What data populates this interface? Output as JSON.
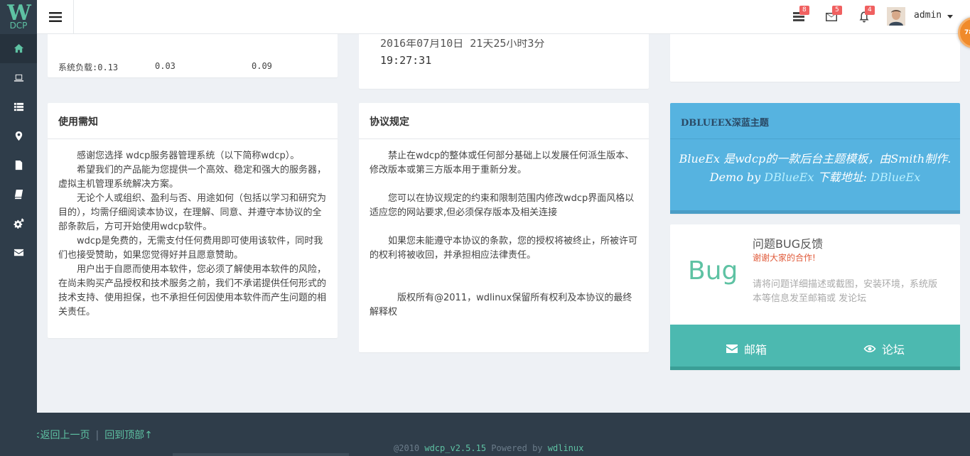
{
  "logo": {
    "w": "W",
    "dcp": "DCP"
  },
  "header": {
    "badges": {
      "tasks": "8",
      "mail": "5",
      "bell": "4"
    },
    "user": "admin",
    "float_ball": "78"
  },
  "system": {
    "load_label": "系统负载:0.13",
    "load_5": "0.03",
    "load_15": "0.09"
  },
  "time": {
    "partial": "2016年07月10日     21天25小时3分",
    "clock": "19:27:31"
  },
  "notice": {
    "title": "使用需知",
    "paragraphs": [
      "感谢您选择 wdcp服务器管理系统（以下简称wdcp）。",
      "希望我们的产品能为您提供一个高效、稳定和强大的服务器，虚拟主机管理系统解决方案。",
      "无论个人或组织、盈利与否、用途如何（包括以学习和研究为目的），均需仔细阅读本协议，在理解、同意、并遵守本协议的全部条款后，方可开始使用wdcp软件。",
      "wdcp是免费的，无需支付任何费用即可使用该软件，同时我们也接受赞助，如果您觉得好并且愿意赞助。",
      "用户出于自愿而使用本软件，您必须了解使用本软件的风险，在尚未购买产品授权和技术服务之前，我们不承诺提供任何形式的技术支持、使用担保，也不承担任何因使用本软件而产生问题的相关责任。"
    ]
  },
  "agreement": {
    "title": "协议规定",
    "paragraphs": [
      "禁止在wdcp的整体或任何部分基础上以发展任何派生版本、修改版本或第三方版本用于重新分发。",
      "您可以在协议规定的约束和限制范围内修改wdcp界面风格以适应您的网站要求,但必须保存版本及相关连接",
      "如果您未能遵守本协议的条款，您的授权将被终止，所被许可的权利将被收回，并承担相应法律责任。",
      "版权所有@2011，wdlinux保留所有权利及本协议的最终解释权"
    ]
  },
  "theme": {
    "title": "DBLUEEX深蓝主题",
    "body_1": "BlueEx 是wdcp的一款后台主题模板，由Smith制作. Demo by ",
    "link_1": "DBlueEx",
    "body_2": " 下载地址: ",
    "link_2": "DBlueEx"
  },
  "bug": {
    "big": "Bug",
    "title": "问题BUG反馈",
    "subtitle": "谢谢大家的合作!",
    "desc": "请将问题详细描述或截图，安装环境，系统版本等信息发至邮箱或 发论坛",
    "mail_label": "邮箱",
    "forum_label": "论坛"
  },
  "footer": {
    "back": "<<返回上一页",
    "sep": "|",
    "top": "回到顶部↑",
    "copy_prefix": "@2010 ",
    "version": "wdcp_v2.5.15",
    "powered": " Powered by ",
    "brand": "wdlinux"
  }
}
